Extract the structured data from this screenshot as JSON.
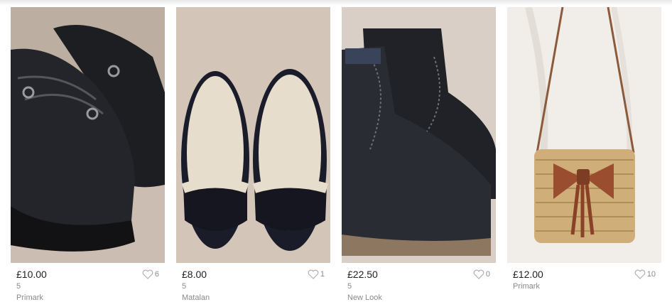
{
  "items": [
    {
      "price": "£10.00",
      "size": "5",
      "brand": "Primark",
      "likes": "6",
      "photo": "black suede creeper shoes"
    },
    {
      "price": "£8.00",
      "size": "5",
      "brand": "Matalan",
      "likes": "1",
      "photo": "black and cream ballet flats"
    },
    {
      "price": "£22.50",
      "size": "5",
      "brand": "New Look",
      "likes": "0",
      "photo": "black suede ankle boots"
    },
    {
      "price": "£12.00",
      "size": "",
      "brand": "Primark",
      "likes": "10",
      "photo": "wicker crossbody bag with bow"
    }
  ],
  "icons": {
    "favourite": "heart-outline-icon"
  }
}
